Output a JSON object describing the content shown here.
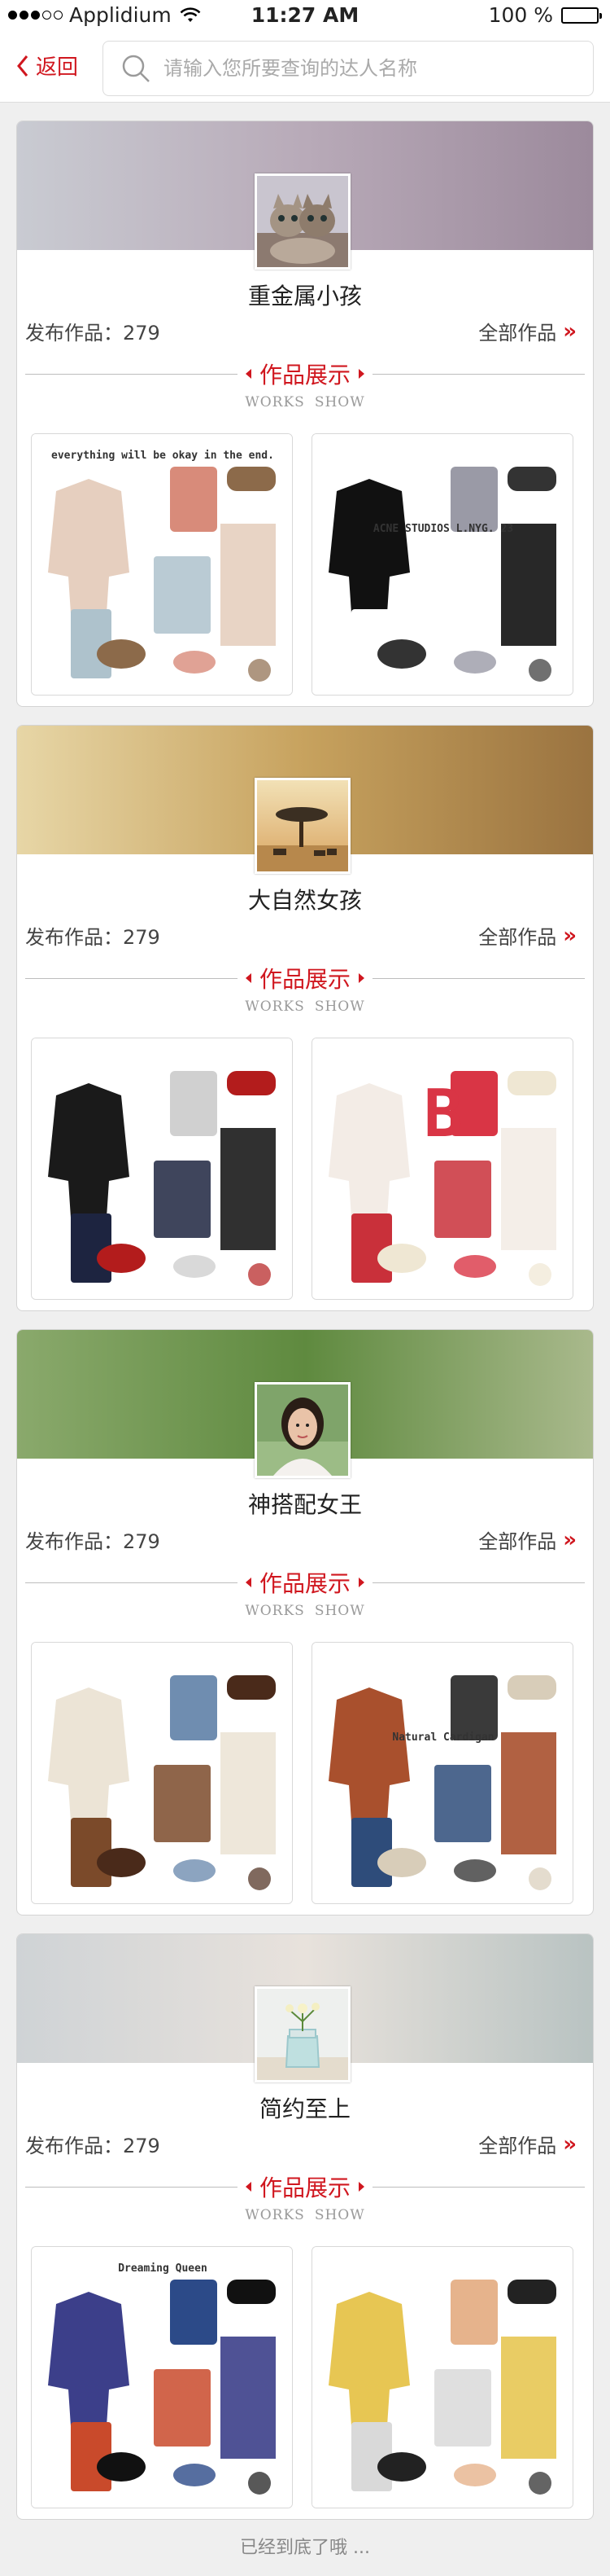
{
  "status_bar": {
    "carrier": "Applidium",
    "time": "11:27 AM",
    "battery": "100 %"
  },
  "nav": {
    "back_label": "返回",
    "search_placeholder": "请输入您所要查询的达人名称"
  },
  "section_title": "作品展示",
  "section_subtitle": [
    "WORKS",
    "SHOW"
  ],
  "count_label": "发布作品：",
  "all_works_label": "全部作品",
  "chevron": "»",
  "experts": [
    {
      "name": "重金属小孩",
      "works_count": "279",
      "banner_colors": [
        "#c9cbd2",
        "#b8aab8",
        "#9c8a9c"
      ],
      "avatar": "cats-avatar",
      "works": [
        {
          "name": "outfit-knit-sweater-collage",
          "caption": "everything will be okay in the end.",
          "colors": [
            "#e6cfbf",
            "#aec2cc",
            "#d88b7a",
            "#8c6a4a"
          ]
        },
        {
          "name": "outfit-black-velvet-collage",
          "caption": "ACNE STUDIOS L.NYG. 23",
          "colors": [
            "#111111",
            "#ffffff",
            "#9a9aa6",
            "#333333"
          ]
        }
      ]
    },
    {
      "name": "大自然女孩",
      "works_count": "279",
      "banner_colors": [
        "#e7d6a6",
        "#c7a25e",
        "#9a7340"
      ],
      "avatar": "savanna-avatar",
      "works": [
        {
          "name": "outfit-graphic-sweatshirt-collage",
          "caption": "",
          "colors": [
            "#1a1a1a",
            "#1d2440",
            "#d0d0d0",
            "#b31c1c"
          ]
        },
        {
          "name": "outfit-polka-dot-collage",
          "caption": "B",
          "colors": [
            "#f3ece6",
            "#c9303a",
            "#d93545",
            "#efe7d3"
          ]
        }
      ]
    },
    {
      "name": "神搭配女王",
      "works_count": "279",
      "banner_colors": [
        "#8aa96c",
        "#5f8a3f",
        "#a9b98c"
      ],
      "avatar": "woman-portrait-avatar",
      "works": [
        {
          "name": "outfit-nordic-sweater-collage",
          "caption": "",
          "colors": [
            "#ece4d6",
            "#7b4a2a",
            "#6f8db0",
            "#4a2a1a"
          ]
        },
        {
          "name": "outfit-rust-cardigan-collage",
          "caption": "Natural Cardigan",
          "colors": [
            "#a9502d",
            "#2e4c7a",
            "#3a3a3a",
            "#d8cdb9"
          ]
        }
      ]
    },
    {
      "name": "简约至上",
      "works_count": "279",
      "banner_colors": [
        "#cfd3d6",
        "#e8e2dc",
        "#b9c3c2"
      ],
      "avatar": "flower-jar-avatar",
      "works": [
        {
          "name": "outfit-plaid-blouse-collage",
          "caption": "Dreaming Queen",
          "colors": [
            "#3c3f8a",
            "#c94a2b",
            "#2c4a88",
            "#111111"
          ]
        },
        {
          "name": "outfit-yellow-stripe-collage",
          "caption": "",
          "colors": [
            "#e7c653",
            "#d9d9d9",
            "#e6b38c",
            "#222222"
          ]
        }
      ]
    }
  ],
  "footer": "已经到底了哦 ..."
}
